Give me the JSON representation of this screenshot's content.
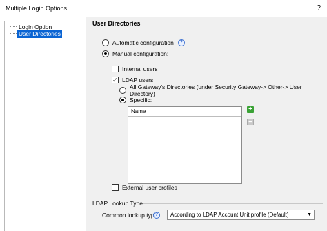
{
  "window": {
    "title": "Multiple Login Options",
    "help_label": "?"
  },
  "tree": {
    "items": [
      {
        "label": "Login Option",
        "selected": false
      },
      {
        "label": "User Directories",
        "selected": true
      }
    ]
  },
  "panel": {
    "section_title": "User Directories",
    "automatic_label": "Automatic configuration",
    "manual_label": "Manual configuration:",
    "internal_users_label": "Internal users",
    "ldap_users_label": "LDAP users",
    "all_gateway_label": "All Gateway's Directories (under Security Gateway-> Other-> User Directory)",
    "specific_label": "Specific:",
    "list_header": "Name",
    "external_profiles_label": "External user profiles",
    "plus_label": "+",
    "minus_label": "−"
  },
  "lookup": {
    "group_label": "LDAP Lookup Type",
    "common_label": "Common lookup type:",
    "selected_value": "According to LDAP Account Unit profile (Default)"
  },
  "state": {
    "automatic": false,
    "manual": true,
    "internal_users": false,
    "ldap_users": true,
    "all_gateway": false,
    "specific": true,
    "external_profiles": false
  },
  "icons": {
    "info": "info-icon",
    "dropdown": "chevron-down-icon"
  },
  "colors": {
    "selection": "#0a64d3",
    "add_button": "#3aa235",
    "info": "#3b6fd0"
  }
}
